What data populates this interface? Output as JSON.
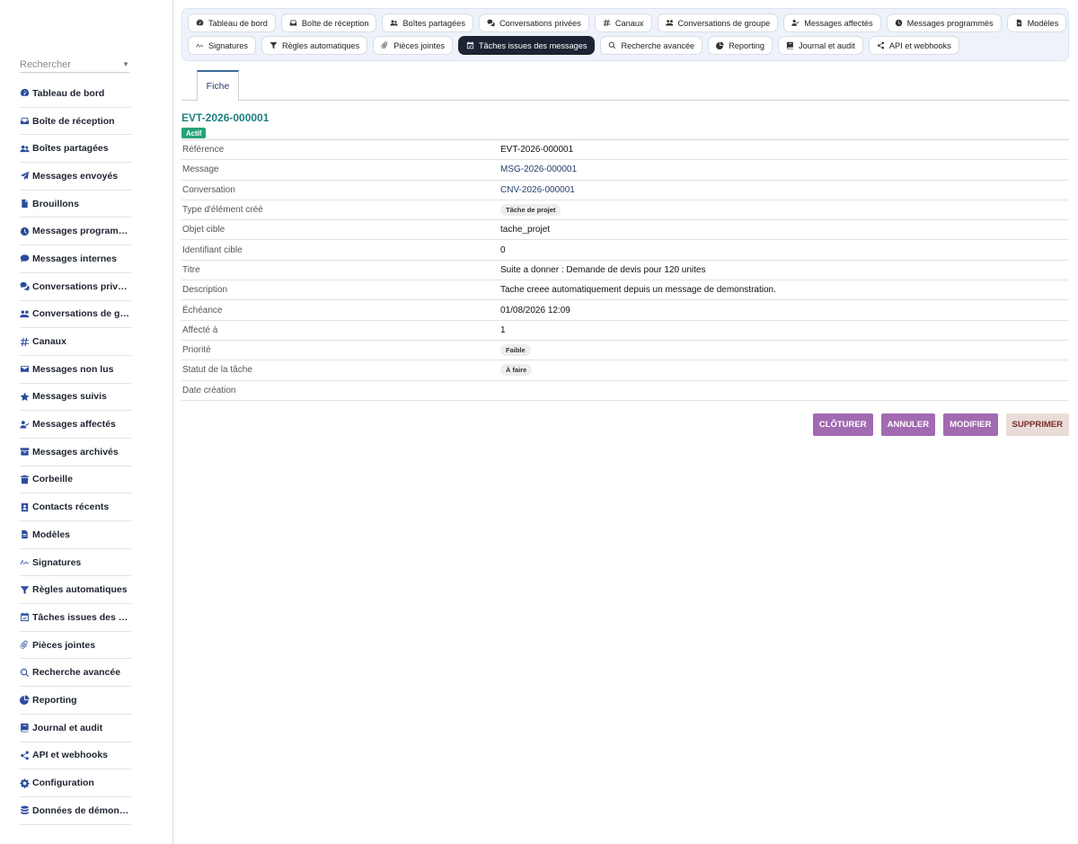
{
  "sidebar": {
    "search_placeholder": "Rechercher",
    "items": [
      {
        "label": "Tableau de bord",
        "icon": "dashboard-icon"
      },
      {
        "label": "Boîte de réception",
        "icon": "inbox-icon"
      },
      {
        "label": "Boîtes partagées",
        "icon": "users-icon"
      },
      {
        "label": "Messages envoyés",
        "icon": "paper-plane-icon"
      },
      {
        "label": "Brouillons",
        "icon": "file-icon"
      },
      {
        "label": "Messages programmés",
        "icon": "clock-icon"
      },
      {
        "label": "Messages internes",
        "icon": "comment-icon"
      },
      {
        "label": "Conversations privées",
        "icon": "comments-icon"
      },
      {
        "label": "Conversations de groupe",
        "icon": "user-group-icon"
      },
      {
        "label": "Canaux",
        "icon": "hashtag-icon"
      },
      {
        "label": "Messages non lus",
        "icon": "envelope-icon"
      },
      {
        "label": "Messages suivis",
        "icon": "star-icon"
      },
      {
        "label": "Messages affectés",
        "icon": "user-check-icon"
      },
      {
        "label": "Messages archivés",
        "icon": "archive-icon"
      },
      {
        "label": "Corbeille",
        "icon": "trash-icon"
      },
      {
        "label": "Contacts récents",
        "icon": "contact-icon"
      },
      {
        "label": "Modèles",
        "icon": "file-lines-icon"
      },
      {
        "label": "Signatures",
        "icon": "signature-icon"
      },
      {
        "label": "Règles automatiques",
        "icon": "filter-icon"
      },
      {
        "label": "Tâches issues des messages",
        "icon": "calendar-check-icon"
      },
      {
        "label": "Pièces jointes",
        "icon": "paperclip-icon"
      },
      {
        "label": "Recherche avancée",
        "icon": "search-icon"
      },
      {
        "label": "Reporting",
        "icon": "chart-pie-icon"
      },
      {
        "label": "Journal et audit",
        "icon": "book-icon"
      },
      {
        "label": "API et webhooks",
        "icon": "share-icon"
      },
      {
        "label": "Configuration",
        "icon": "gear-icon"
      },
      {
        "label": "Données de démonstration",
        "icon": "database-icon"
      }
    ]
  },
  "topnav": {
    "row1": [
      {
        "label": "Tableau de bord",
        "icon": "dashboard-icon"
      },
      {
        "label": "Boîte de réception",
        "icon": "inbox-icon"
      },
      {
        "label": "Boîtes partagées",
        "icon": "users-icon"
      },
      {
        "label": "Conversations privées",
        "icon": "comments-icon"
      },
      {
        "label": "Canaux",
        "icon": "hashtag-icon"
      },
      {
        "label": "Conversations de groupe",
        "icon": "user-group-icon"
      },
      {
        "label": "Messages affectés",
        "icon": "user-check-icon"
      },
      {
        "label": "Messages programmés",
        "icon": "clock-icon"
      },
      {
        "label": "Modèles",
        "icon": "file-lines-icon"
      }
    ],
    "row2": [
      {
        "label": "Signatures",
        "icon": "signature-icon"
      },
      {
        "label": "Règles automatiques",
        "icon": "filter-icon"
      },
      {
        "label": "Pièces jointes",
        "icon": "paperclip-icon"
      },
      {
        "label": "Tâches issues des messages",
        "icon": "calendar-check-icon",
        "active": true
      },
      {
        "label": "Recherche avancée",
        "icon": "search-icon"
      },
      {
        "label": "Reporting",
        "icon": "chart-pie-icon"
      },
      {
        "label": "Journal et audit",
        "icon": "book-icon"
      },
      {
        "label": "API et webhooks",
        "icon": "share-icon"
      }
    ]
  },
  "content_tab": "Fiche",
  "record": {
    "title": "EVT-2026-000001",
    "status": "Actif",
    "fields": [
      {
        "key": "Référence",
        "value": "EVT-2026-000001",
        "kind": "text"
      },
      {
        "key": "Message",
        "value": "MSG-2026-000001",
        "kind": "link"
      },
      {
        "key": "Conversation",
        "value": "CNV-2026-000001",
        "kind": "link"
      },
      {
        "key": "Type d'élément créé",
        "value": "Tâche de projet",
        "kind": "pill"
      },
      {
        "key": "Objet cible",
        "value": "tache_projet",
        "kind": "text"
      },
      {
        "key": "Identifiant cible",
        "value": "0",
        "kind": "text"
      },
      {
        "key": "Titre",
        "value": "Suite a donner : Demande de devis pour 120 unites",
        "kind": "text"
      },
      {
        "key": "Description",
        "value": "Tache creee automatiquement depuis un message de demonstration.",
        "kind": "text"
      },
      {
        "key": "Échéance",
        "value": "01/08/2026 12:09",
        "kind": "text"
      },
      {
        "key": "Affecté à",
        "value": "1",
        "kind": "text"
      },
      {
        "key": "Priorité",
        "value": "Faible",
        "kind": "pill"
      },
      {
        "key": "Statut de la tâche",
        "value": "À faire",
        "kind": "pill"
      },
      {
        "key": "Date création",
        "value": "",
        "kind": "text"
      }
    ]
  },
  "actions": {
    "close_label": "CLÔTURER",
    "cancel_label": "ANNULER",
    "edit_label": "MODIFIER",
    "delete_label": "SUPPRIMER"
  },
  "colors": {
    "accent": "#a16ab1",
    "active_tab": "#1c2333",
    "title": "#1d7f7f",
    "status_badge": "#26a37a",
    "icon": "#2b4c9c"
  }
}
